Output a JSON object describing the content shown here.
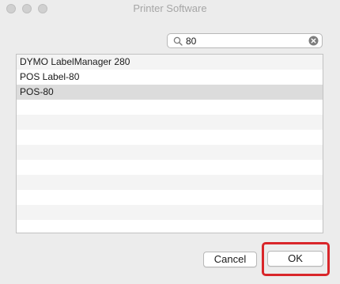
{
  "window": {
    "title": "Printer Software"
  },
  "search": {
    "value": "80",
    "icon": "magnifier",
    "clear_icon": "clear-x"
  },
  "list": {
    "rows": [
      {
        "label": "DYMO LabelManager 280",
        "selected": false
      },
      {
        "label": "POS Label-80",
        "selected": false
      },
      {
        "label": "POS-80",
        "selected": true
      },
      {
        "label": "",
        "selected": false
      },
      {
        "label": "",
        "selected": false
      },
      {
        "label": "",
        "selected": false
      },
      {
        "label": "",
        "selected": false
      },
      {
        "label": "",
        "selected": false
      },
      {
        "label": "",
        "selected": false
      },
      {
        "label": "",
        "selected": false
      },
      {
        "label": "",
        "selected": false
      },
      {
        "label": "",
        "selected": false
      }
    ]
  },
  "buttons": {
    "cancel": "Cancel",
    "ok": "OK"
  },
  "colors": {
    "highlight": "#d9262a",
    "selected_row": "#dcdcdc"
  }
}
